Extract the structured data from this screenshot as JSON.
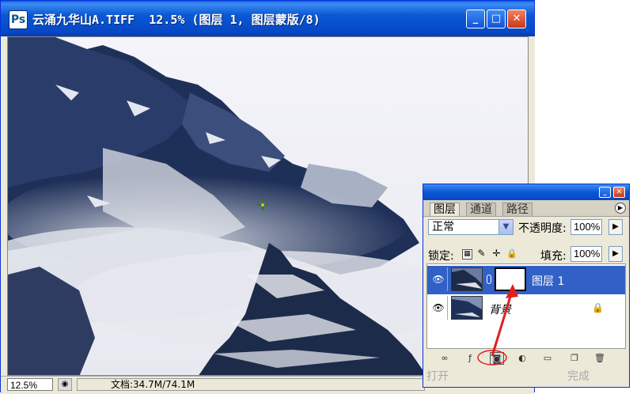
{
  "window": {
    "title": "云涌九华山A.TIFF  12.5% (图层 1, 图层蒙版/8)",
    "app_icon": "photoshop-document-icon",
    "controls": {
      "minimize": "_",
      "maximize": "□",
      "close": "✕"
    }
  },
  "status": {
    "zoom": "12.5%",
    "doc_info": "文档:34.7M/74.1M"
  },
  "layers_panel": {
    "tabs": [
      "图层",
      "通道",
      "路径"
    ],
    "active_tab": "图层",
    "blend_mode": "正常",
    "opacity_label": "不透明度:",
    "opacity_value": "100%",
    "lock_label": "锁定:",
    "fill_label": "填充:",
    "fill_value": "100%",
    "layers": [
      {
        "name": "图层 1",
        "selected": true,
        "has_mask": true
      },
      {
        "name": "背景",
        "selected": false,
        "locked": true
      }
    ],
    "footer_left_text": "打开",
    "footer_right_text": "完成"
  },
  "colors": {
    "titlebar": "#0a58d4",
    "selection": "#3161c6",
    "annotation": "#e02020"
  }
}
